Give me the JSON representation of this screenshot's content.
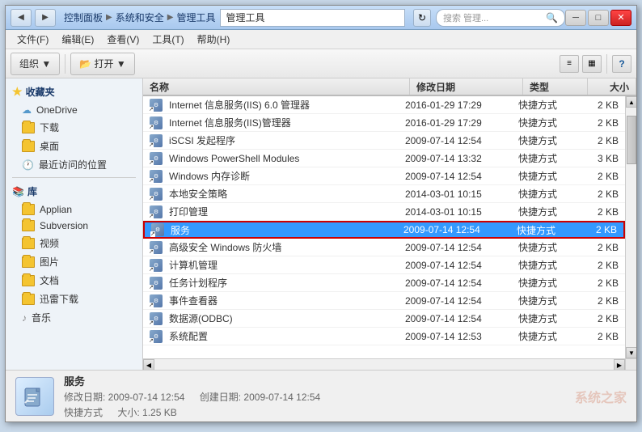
{
  "window": {
    "title": "管理工具",
    "controls": {
      "minimize": "─",
      "maximize": "□",
      "close": "✕"
    }
  },
  "titlebar": {
    "back_btn": "◀",
    "forward_btn": "▶",
    "path": [
      "控制面板",
      "系统和安全",
      "管理工具"
    ],
    "path_arrows": [
      "▶",
      "▶"
    ],
    "address_text": "管理工具",
    "refresh_icon": "↻",
    "search_placeholder": "搜索 管理...",
    "search_icon": "🔍"
  },
  "menubar": {
    "items": [
      "文件(F)",
      "编辑(E)",
      "查看(V)",
      "工具(T)",
      "帮助(H)"
    ]
  },
  "toolbar": {
    "organize_label": "组织 ▼",
    "open_label": "📂 打开 ▼",
    "view_icon": "≡",
    "view2_icon": "▦",
    "help_icon": "?"
  },
  "columns": {
    "name": "名称",
    "date": "修改日期",
    "type": "类型",
    "size": "大小"
  },
  "sidebar": {
    "sections": [
      {
        "id": "favorites",
        "header": "收藏夹",
        "icon": "★",
        "items": [
          {
            "label": "OneDrive",
            "icon": "cloud"
          },
          {
            "label": "下载",
            "icon": "folder"
          },
          {
            "label": "桌面",
            "icon": "folder"
          },
          {
            "label": "最近访问的位置",
            "icon": "clock"
          }
        ]
      },
      {
        "id": "library",
        "header": "库",
        "icon": "lib",
        "items": [
          {
            "label": "Applian",
            "icon": "folder"
          },
          {
            "label": "Subversion",
            "icon": "folder"
          },
          {
            "label": "视频",
            "icon": "folder"
          },
          {
            "label": "图片",
            "icon": "folder"
          },
          {
            "label": "文档",
            "icon": "folder"
          },
          {
            "label": "迅雷下载",
            "icon": "folder"
          },
          {
            "label": "音乐",
            "icon": "music"
          }
        ]
      }
    ]
  },
  "files": [
    {
      "name": "Internet 信息服务(IIS) 6.0 管理器",
      "date": "2016-01-29 17:29",
      "type": "快捷方式",
      "size": "2 KB",
      "selected": false
    },
    {
      "name": "Internet 信息服务(IIS)管理器",
      "date": "2016-01-29 17:29",
      "type": "快捷方式",
      "size": "2 KB",
      "selected": false
    },
    {
      "name": "iSCSI 发起程序",
      "date": "2009-07-14 12:54",
      "type": "快捷方式",
      "size": "2 KB",
      "selected": false
    },
    {
      "name": "Windows PowerShell Modules",
      "date": "2009-07-14 13:32",
      "type": "快捷方式",
      "size": "3 KB",
      "selected": false
    },
    {
      "name": "Windows 内存诊断",
      "date": "2009-07-14 12:54",
      "type": "快捷方式",
      "size": "2 KB",
      "selected": false
    },
    {
      "name": "本地安全策略",
      "date": "2014-03-01 10:15",
      "type": "快捷方式",
      "size": "2 KB",
      "selected": false
    },
    {
      "name": "打印管理",
      "date": "2014-03-01 10:15",
      "type": "快捷方式",
      "size": "2 KB",
      "selected": false
    },
    {
      "name": "服务",
      "date": "2009-07-14 12:54",
      "type": "快捷方式",
      "size": "2 KB",
      "selected": true
    },
    {
      "name": "高级安全 Windows 防火墙",
      "date": "2009-07-14 12:54",
      "type": "快捷方式",
      "size": "2 KB",
      "selected": false
    },
    {
      "name": "计算机管理",
      "date": "2009-07-14 12:54",
      "type": "快捷方式",
      "size": "2 KB",
      "selected": false
    },
    {
      "name": "任务计划程序",
      "date": "2009-07-14 12:54",
      "type": "快捷方式",
      "size": "2 KB",
      "selected": false
    },
    {
      "name": "事件查看器",
      "date": "2009-07-14 12:54",
      "type": "快捷方式",
      "size": "2 KB",
      "selected": false
    },
    {
      "name": "数据源(ODBC)",
      "date": "2009-07-14 12:54",
      "type": "快捷方式",
      "size": "2 KB",
      "selected": false
    },
    {
      "name": "系统配置",
      "date": "2009-07-14 12:53",
      "type": "快捷方式",
      "size": "2 KB",
      "selected": false
    }
  ],
  "statusbar": {
    "name": "服务",
    "date_modified": "修改日期: 2009-07-14 12:54",
    "date_created": "创建日期: 2009-07-14 12:54",
    "type": "快捷方式",
    "size": "大小: 1.25 KB",
    "watermark": "系统之家"
  },
  "colors": {
    "selected_bg": "#3399ff",
    "selected_border": "#cc0000",
    "header_bg": "#c8dff8",
    "accent": "#1a3a6a"
  }
}
